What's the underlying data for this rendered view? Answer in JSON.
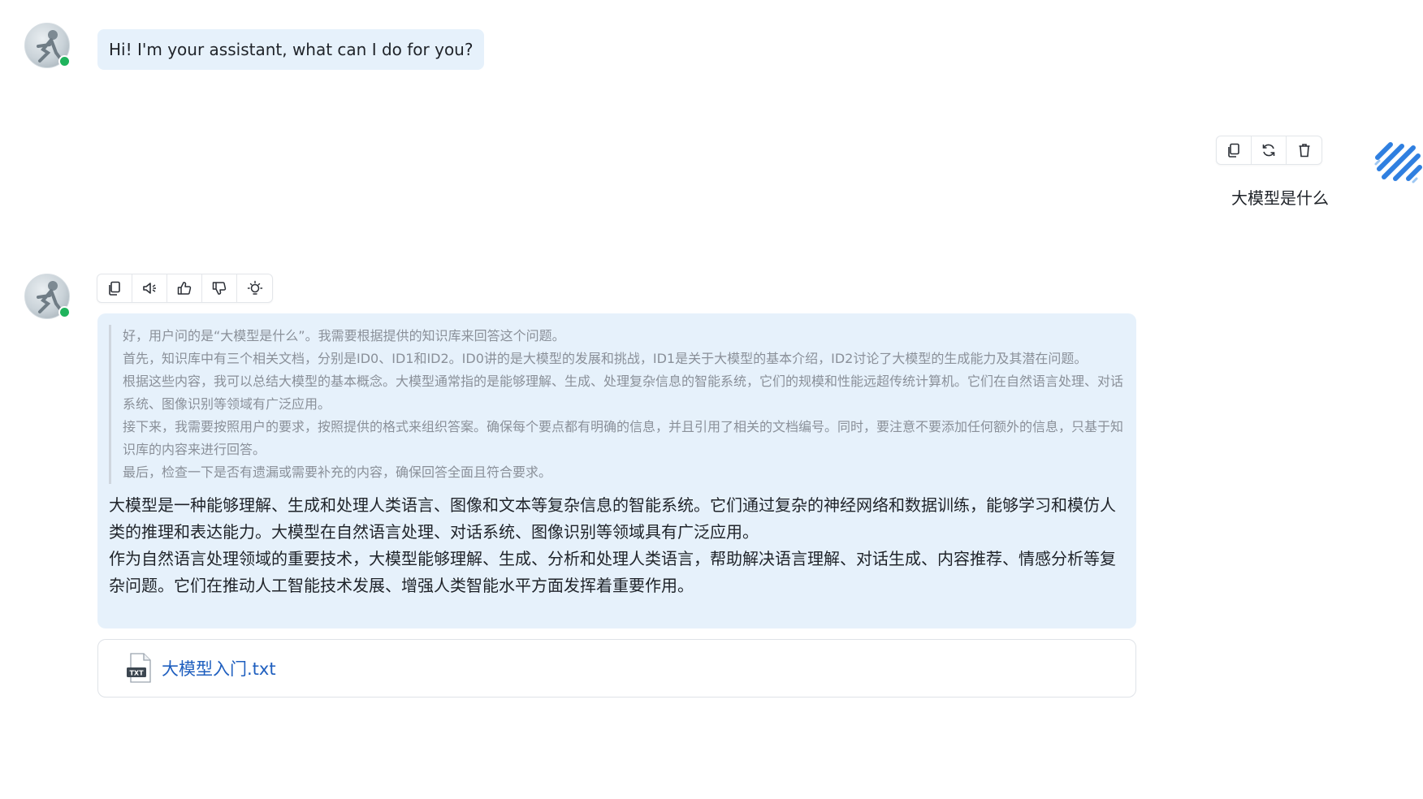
{
  "greeting": {
    "text": "Hi! I'm your assistant, what can I do for you?"
  },
  "user_message": {
    "text": "大模型是什么",
    "actions": [
      "copy-icon",
      "refresh-icon",
      "trash-icon"
    ]
  },
  "answer": {
    "actions": [
      "copy-icon",
      "speaker-icon",
      "thumbs-up-icon",
      "thumbs-down-icon",
      "lightbulb-icon"
    ],
    "thinking": [
      "好，用户问的是“大模型是什么”。我需要根据提供的知识库来回答这个问题。",
      "首先，知识库中有三个相关文档，分别是ID0、ID1和ID2。ID0讲的是大模型的发展和挑战，ID1是关于大模型的基本介绍，ID2讨论了大模型的生成能力及其潜在问题。",
      "根据这些内容，我可以总结大模型的基本概念。大模型通常指的是能够理解、生成、处理复杂信息的智能系统，它们的规模和性能远超传统计算机。它们在自然语言处理、对话系统、图像识别等领域有广泛应用。",
      "接下来，我需要按照用户的要求，按照提供的格式来组织答案。确保每个要点都有明确的信息，并且引用了相关的文档编号。同时，要注意不要添加任何额外的信息，只基于知识库的内容来进行回答。",
      "最后，检查一下是否有遗漏或需要补充的内容，确保回答全面且符合要求。"
    ],
    "paragraphs": [
      "大模型是一种能够理解、生成和处理人类语言、图像和文本等复杂信息的智能系统。它们通过复杂的神经网络和数据训练，能够学习和模仿人类的推理和表达能力。大模型在自然语言处理、对话系统、图像识别等领域具有广泛应用。",
      "作为自然语言处理领域的重要技术，大模型能够理解、生成、分析和处理人类语言，帮助解决语言理解、对话生成、内容推荐、情感分析等复杂问题。它们在推动人工智能技术发展、增强人类智能水平方面发挥着重要作用。"
    ]
  },
  "attachment": {
    "file_name": "大模型入门.txt",
    "file_type_badge": "TXT"
  },
  "colors": {
    "bubble": "#e6f1fb",
    "online": "#1fb35c",
    "link": "#1f5fbf",
    "accent": "#2f7fe0"
  }
}
